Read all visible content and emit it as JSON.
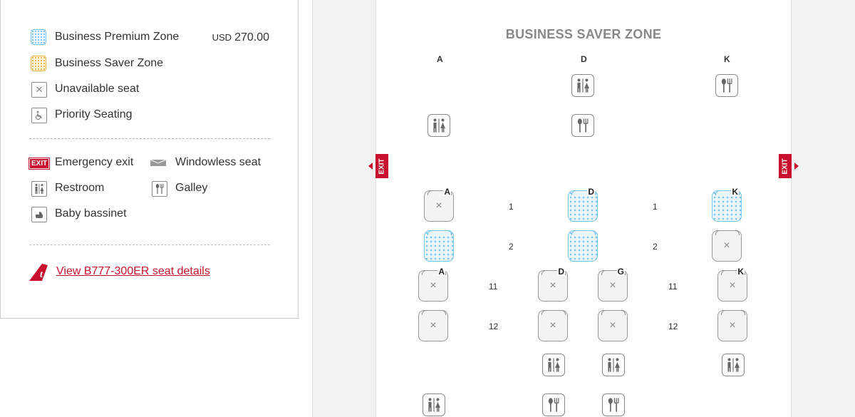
{
  "legend": {
    "premium_label": "Business Premium Zone",
    "premium_currency": "USD",
    "premium_price": "270.00",
    "saver_label": "Business Saver Zone",
    "unavailable_label": "Unavailable seat",
    "priority_label": "Priority Seating",
    "exit_badge": "EXIT",
    "exit_label": "Emergency exit",
    "windowless_label": "Windowless seat",
    "restroom_label": "Restroom",
    "galley_label": "Galley",
    "bassinet_label": "Baby bassinet",
    "link_label": "View B777-300ER seat details"
  },
  "seatmap": {
    "zone_title": "BUSINESS SAVER ZONE",
    "columns": [
      "A",
      "D",
      "K"
    ],
    "exit_text": "EXIT",
    "rows": {
      "r1": "1",
      "r1b": "1",
      "r2": "2",
      "r2b": "2",
      "r11": "11",
      "r11b": "11",
      "r12": "12",
      "r12b": "12"
    },
    "seat_letters": {
      "a": "A",
      "d": "D",
      "g": "G",
      "k": "K"
    },
    "unavailable_mark": "×"
  },
  "colors": {
    "brand_red": "#c8102e",
    "premium_blue": "#7cc3ea",
    "saver_yellow": "#e8b44a"
  },
  "icons": [
    "restroom-icon",
    "galley-icon",
    "wheelchair-icon",
    "bassinet-icon",
    "windowless-icon",
    "brand-logo-icon"
  ]
}
